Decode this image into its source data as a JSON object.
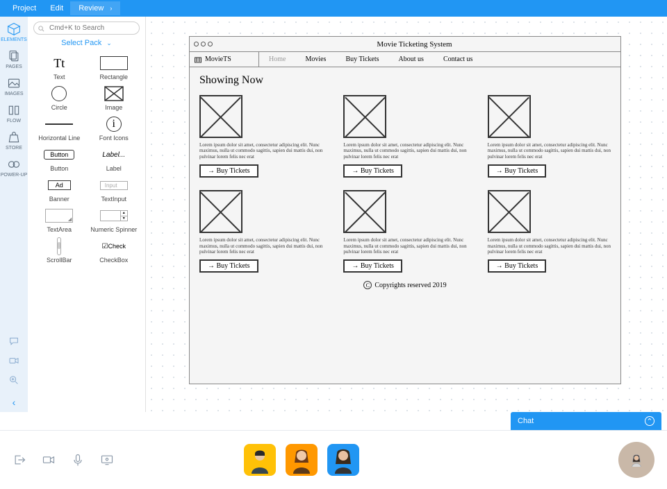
{
  "menubar": {
    "items": [
      "Project",
      "Edit"
    ],
    "review": "Review"
  },
  "left_tools": [
    {
      "id": "elements",
      "label": "ELEMENTS"
    },
    {
      "id": "pages",
      "label": "PAGES"
    },
    {
      "id": "images",
      "label": "IMAGES"
    },
    {
      "id": "flow",
      "label": "FLOW"
    },
    {
      "id": "store",
      "label": "STORE"
    },
    {
      "id": "powerup",
      "label": "POWER-UP"
    }
  ],
  "search": {
    "placeholder": "Cmd+K to Search"
  },
  "select_pack": "Select Pack",
  "elements": [
    {
      "name": "Text"
    },
    {
      "name": "Rectangle"
    },
    {
      "name": "Circle"
    },
    {
      "name": "Image"
    },
    {
      "name": "Horizontal Line"
    },
    {
      "name": "Font Icons"
    },
    {
      "name": "Button",
      "badge": "Button"
    },
    {
      "name": "Label",
      "badge": "Label..."
    },
    {
      "name": "Banner",
      "badge": "Ad"
    },
    {
      "name": "TextInput",
      "badge": "Input"
    },
    {
      "name": "TextArea"
    },
    {
      "name": "Numeric Spinner"
    },
    {
      "name": "ScrollBar"
    },
    {
      "name": "CheckBox",
      "badge": "Check"
    }
  ],
  "mockup": {
    "window_title": "Movie Ticketing System",
    "brand": "MovieTS",
    "nav": [
      "Home",
      "Movies",
      "Buy Tickets",
      "About us",
      "Contact us"
    ],
    "heading": "Showing Now",
    "card_desc": "Lorem ipsum dolor sit amet, consectetur adipiscing elit. Nunc maximus, nulla ut commodo sagittis, sapien dui mattis dui, non pulvinar lorem felis nec erat",
    "card_btn": "→ Buy Tickets",
    "footer": "Copyrights reserved 2019"
  },
  "chat": {
    "label": "Chat"
  }
}
